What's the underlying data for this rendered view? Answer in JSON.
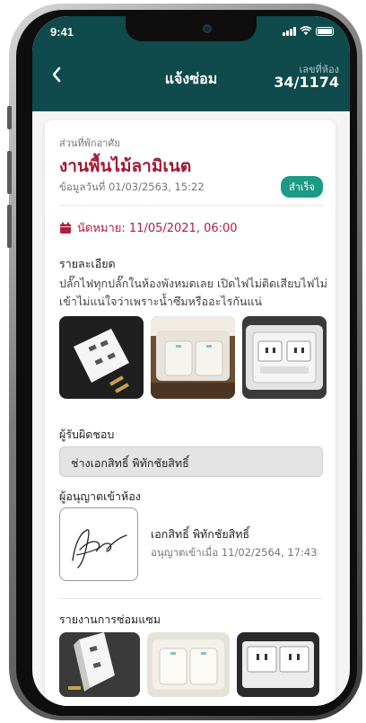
{
  "status_bar": {
    "time": "9:41"
  },
  "header": {
    "title": "แจ้งซ่อม",
    "room_label": "เลขที่ห้อง",
    "room_number": "34/1174"
  },
  "request": {
    "section_label": "ส่วนที่พักอาศัย",
    "title": "งานพื้นไม้ลามิเนต",
    "date_line": "ข้อมูลวันที่ 01/03/2563, 15:22",
    "status": "สำเร็จ",
    "appointment": "นัดหมาย: 11/05/2021, 06:00",
    "detail_label": "รายละเอียด",
    "detail_text": "ปลั๊กไฟทุกปลั๊กในห้องพังหมดเลย เปิดไฟไม่ติดเสียบไฟไม่เข้าไม่แน่ใจว่าเพราะน้ำซึมหรืออะไรกันแน่",
    "responsible_label": "ผู้รับผิดชอบ",
    "responsible_name": "ช่างเอกสิทธิ์ พิทักชัยสิทธิ์",
    "permission_label": "ผู้อนุญาตเข้าห้อง",
    "permission_name": "เอกสิทธิ์ พิทักชัยสิทธิ์",
    "permission_time": "อนุญาตเข้าเมื่อ 11/02/2564, 17:43",
    "repair_report_label": "รายงานการซ่อมแซม"
  },
  "colors": {
    "header_bg": "#0f4a4d",
    "title_red": "#a11a36",
    "badge_green": "#1b9a86",
    "appointment_red": "#b51d3b"
  }
}
